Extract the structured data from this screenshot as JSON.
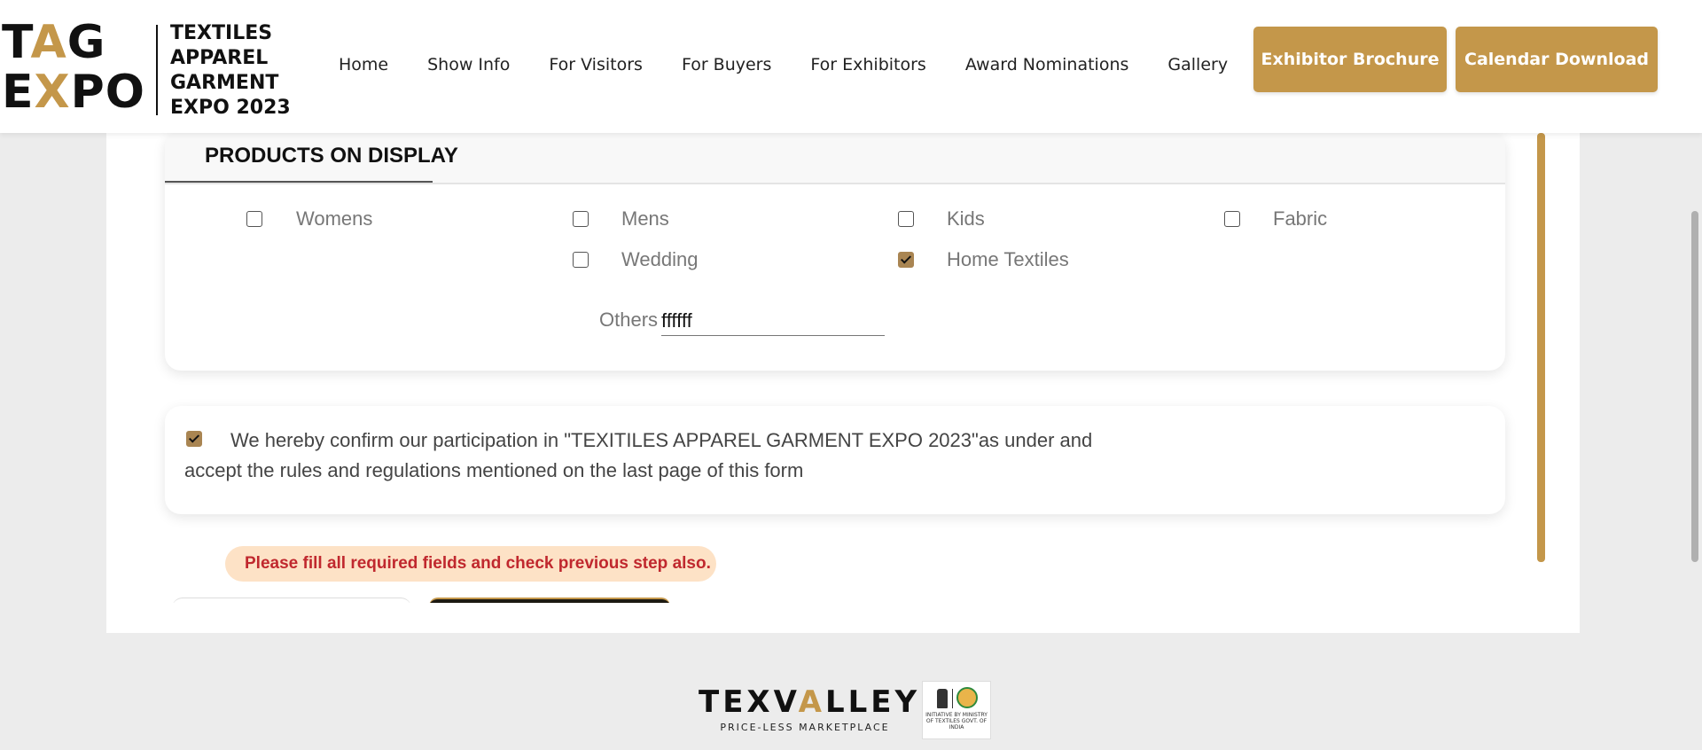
{
  "header": {
    "logo_tag_line1": "TAG",
    "logo_tag_line2": "EXPO",
    "logo_sub": [
      "TEXTILES",
      "APPAREL",
      "GARMENT",
      "EXPO 2023"
    ],
    "nav": [
      "Home",
      "Show Info",
      "For Visitors",
      "For Buyers",
      "For Exhibitors",
      "Award Nominations",
      "Gallery"
    ],
    "brochure_label": "Exhibitor Brochure",
    "calendar_label": "Calendar Download",
    "accent_color": "#c4974a"
  },
  "products": {
    "title": "PRODUCTS ON DISPLAY",
    "options": [
      {
        "label": "Womens",
        "checked": false
      },
      {
        "label": "Mens",
        "checked": false
      },
      {
        "label": "Kids",
        "checked": false
      },
      {
        "label": "Fabric",
        "checked": false
      },
      {
        "label": "Wedding",
        "checked": false
      },
      {
        "label": "Home Textiles",
        "checked": true
      }
    ],
    "others_label": "Others",
    "others_value": "ffffff"
  },
  "confirm": {
    "checked": true,
    "text": "We hereby confirm our participation in \"TEXITILES APPAREL GARMENT EXPO 2023\"as under and accept the rules and regulations mentioned on the last page of this form"
  },
  "error": {
    "message": "Please fill all required fields and check previous step also."
  },
  "footer": {
    "brand": "TEXVALLEY",
    "tagline": "PRICE-LESS MARKETPLACE",
    "ministry_text": "INITIATIVE BY MINISTRY OF TEXTILES GOVT. OF INDIA"
  }
}
